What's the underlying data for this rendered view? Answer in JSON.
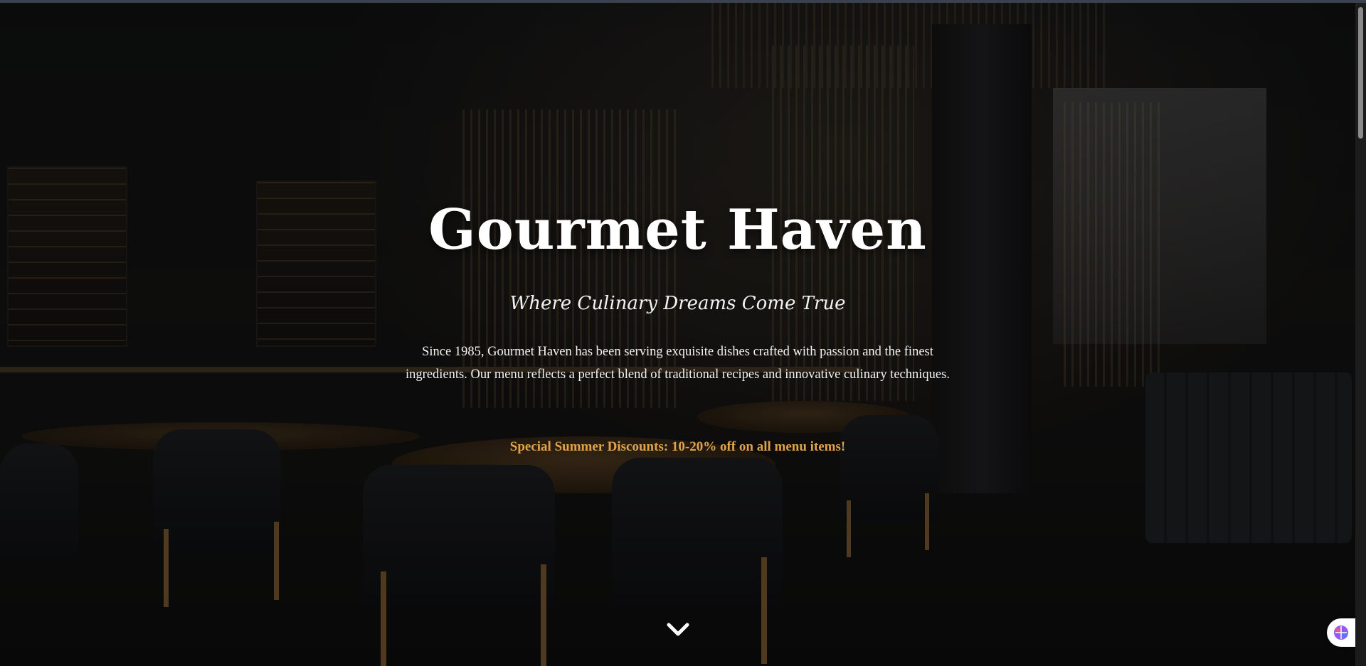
{
  "hero": {
    "title": "Gourmet Haven",
    "tagline": "Where Culinary Dreams Come True",
    "description": "Since 1985, Gourmet Haven has been serving exquisite dishes crafted with passion and the finest ingredients. Our menu reflects a perfect blend of traditional recipes and innovative culinary techniques.",
    "promo": "Special Summer Discounts: 10-20% off on all menu items!",
    "scroll_icon": "chevron-down-icon",
    "background": "restaurant-interior-photo"
  },
  "colors": {
    "promo": "#e0a34a",
    "text": "#ffffff",
    "overlay": "rgba(0,0,0,0.52)"
  },
  "widgets": {
    "extension_icon": "brain-icon"
  }
}
